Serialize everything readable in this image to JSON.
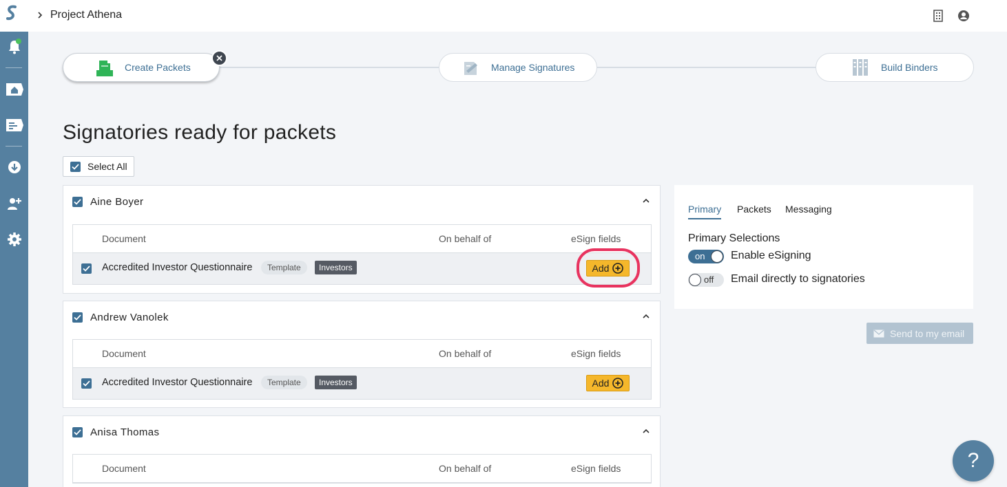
{
  "app": {
    "breadcrumb_title": "Project Athena",
    "icons": {
      "logo": "logo-icon",
      "building": "building-icon",
      "account": "user-circle-icon"
    }
  },
  "sidebar": {
    "items": [
      {
        "name": "notifications",
        "icon": "bell-icon"
      },
      {
        "name": "home",
        "icon": "home-icon"
      },
      {
        "name": "packets",
        "icon": "id-card-icon"
      },
      {
        "name": "download",
        "icon": "download-icon"
      },
      {
        "name": "add-user",
        "icon": "add-user-icon"
      },
      {
        "name": "settings",
        "icon": "gear-icon"
      }
    ]
  },
  "stepper": {
    "steps": [
      {
        "label": "Create Packets",
        "icon": "packet-icon",
        "active": true
      },
      {
        "label": "Manage Signatures",
        "icon": "signature-icon",
        "active": false
      },
      {
        "label": "Build Binders",
        "icon": "binder-icon",
        "active": false
      }
    ]
  },
  "main": {
    "title": "Signatories ready for packets",
    "select_all_label": "Select All",
    "columns": {
      "document": "Document",
      "on_behalf_of": "On behalf of",
      "esign_fields": "eSign fields"
    },
    "signatories": [
      {
        "name": "Aine Boyer",
        "document": "Accredited Investor Questionnaire",
        "tag1": "Template",
        "tag2": "Investors",
        "add_label": "Add"
      },
      {
        "name": "Andrew Vanolek",
        "document": "Accredited Investor Questionnaire",
        "tag1": "Template",
        "tag2": "Investors",
        "add_label": "Add"
      },
      {
        "name": "Anisa Thomas"
      }
    ]
  },
  "right_panel": {
    "tabs": [
      "Primary",
      "Packets",
      "Messaging"
    ],
    "active_tab": "Primary",
    "section_title": "Primary Selections",
    "options": [
      {
        "toggle": "on",
        "label": "Enable eSigning"
      },
      {
        "toggle": "off",
        "label": "Email directly to signatories"
      }
    ],
    "send_button": "Send to my email"
  },
  "help": {
    "label": "?"
  },
  "colors": {
    "sidebar": "#5580a0",
    "accent": "#3d6f94",
    "add_button": "#f5b72b",
    "highlight": "#e8335f",
    "create_icon": "#2fb457"
  }
}
